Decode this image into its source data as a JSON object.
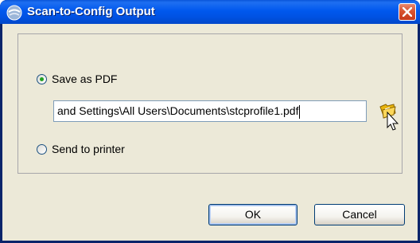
{
  "window": {
    "title": "Scan-to-Config Output",
    "title_icon": "app-globe-icon",
    "close_icon": "close-icon"
  },
  "options": {
    "save_as_pdf": {
      "label": "Save as PDF",
      "checked": true
    },
    "send_to_printer": {
      "label": "Send to printer",
      "checked": false
    }
  },
  "path_field": {
    "value": "and Settings\\All Users\\Documents\\stcprofile1.pdf"
  },
  "browse": {
    "icon": "folder-icon"
  },
  "buttons": {
    "ok_label": "OK",
    "cancel_label": "Cancel"
  },
  "colors": {
    "titlebar": "#0058ee",
    "client": "#ece9d8",
    "close": "#d8532f",
    "radio_dot": "#21a121"
  }
}
